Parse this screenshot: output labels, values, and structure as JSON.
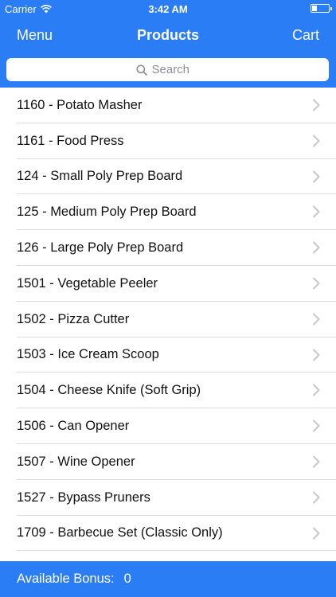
{
  "status": {
    "carrier": "Carrier",
    "time": "3:42 AM"
  },
  "nav": {
    "left": "Menu",
    "title": "Products",
    "right": "Cart"
  },
  "search": {
    "placeholder": "Search"
  },
  "products": [
    "1160 - Potato Masher",
    "1161 - Food Press",
    "124 - Small Poly Prep Board",
    "125 - Medium Poly Prep Board",
    "126 - Large Poly Prep Board",
    "1501 - Vegetable Peeler",
    "1502 - Pizza Cutter",
    "1503 - Ice Cream Scoop",
    "1504 - Cheese Knife (Soft Grip)",
    "1506 - Can Opener",
    "1507 - Wine Opener",
    "1527 - Bypass Pruners",
    "1709 - Barbecue Set (Classic Only)"
  ],
  "bottom": {
    "label": "Available Bonus:",
    "value": "0"
  },
  "colors": {
    "accent": "#2a7df5",
    "separator": "#dcdce0",
    "chevron": "#c7c7cc"
  },
  "icons": {
    "wifi": "wifi-icon",
    "battery": "battery-icon",
    "search": "search-icon",
    "chevron": "chevron-right-icon"
  }
}
